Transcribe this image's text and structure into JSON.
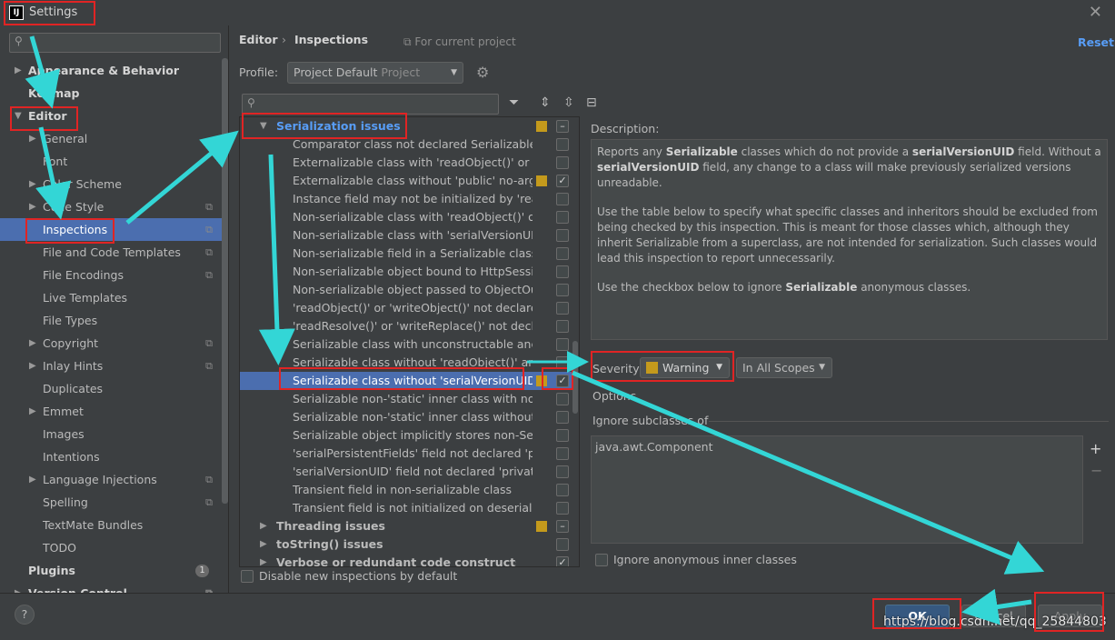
{
  "window": {
    "title": "Settings",
    "app_icon": "IJ"
  },
  "left_panel": {
    "items": [
      {
        "label": "Appearance & Behavior",
        "bold": true,
        "arrow": "right",
        "indent": 0
      },
      {
        "label": "Keymap",
        "bold": true,
        "indent": 0
      },
      {
        "label": "Editor",
        "bold": true,
        "arrow": "down",
        "indent": 0
      },
      {
        "label": "General",
        "arrow": "right",
        "indent": 1
      },
      {
        "label": "Font",
        "indent": 1
      },
      {
        "label": "Color Scheme",
        "arrow": "right",
        "indent": 1
      },
      {
        "label": "Code Style",
        "arrow": "right",
        "indent": 1,
        "copy": true
      },
      {
        "label": "Inspections",
        "indent": 1,
        "copy": true,
        "selected": true
      },
      {
        "label": "File and Code Templates",
        "indent": 1,
        "copy": true
      },
      {
        "label": "File Encodings",
        "indent": 1,
        "copy": true
      },
      {
        "label": "Live Templates",
        "indent": 1
      },
      {
        "label": "File Types",
        "indent": 1
      },
      {
        "label": "Copyright",
        "arrow": "right",
        "indent": 1,
        "copy": true
      },
      {
        "label": "Inlay Hints",
        "arrow": "right",
        "indent": 1,
        "copy": true
      },
      {
        "label": "Duplicates",
        "indent": 1
      },
      {
        "label": "Emmet",
        "arrow": "right",
        "indent": 1
      },
      {
        "label": "Images",
        "indent": 1
      },
      {
        "label": "Intentions",
        "indent": 1
      },
      {
        "label": "Language Injections",
        "arrow": "right",
        "indent": 1,
        "copy": true
      },
      {
        "label": "Spelling",
        "indent": 1,
        "copy": true
      },
      {
        "label": "TextMate Bundles",
        "indent": 1
      },
      {
        "label": "TODO",
        "indent": 1
      },
      {
        "label": "Plugins",
        "bold": true,
        "indent": 0,
        "badge": "1"
      },
      {
        "label": "Version Control",
        "bold": true,
        "arrow": "right",
        "indent": 0,
        "copy": true
      }
    ]
  },
  "header": {
    "crumb_editor": "Editor",
    "crumb_sep": "›",
    "crumb_inspections": "Inspections",
    "for_project": "For current project",
    "reset": "Reset",
    "profile_label": "Profile:",
    "profile_value": "Project Default",
    "profile_scope": "Project"
  },
  "inspections": [
    {
      "label": "Serialization issues",
      "type": "header",
      "sev": true,
      "check": "minus"
    },
    {
      "label": "Comparator class not declared Serializable",
      "check": ""
    },
    {
      "label": "Externalizable class with 'readObject()' or 'writeObject()'",
      "check": ""
    },
    {
      "label": "Externalizable class without 'public' no-arg constructor",
      "sev": true,
      "check": "✓"
    },
    {
      "label": "Instance field may not be initialized by 'readObject()'",
      "check": ""
    },
    {
      "label": "Non-serializable class with 'readObject()' or 'writeObject()'",
      "check": ""
    },
    {
      "label": "Non-serializable class with 'serialVersionUID'",
      "check": ""
    },
    {
      "label": "Non-serializable field in a Serializable class",
      "check": ""
    },
    {
      "label": "Non-serializable object bound to HttpSession",
      "check": ""
    },
    {
      "label": "Non-serializable object passed to ObjectOutputStream",
      "check": ""
    },
    {
      "label": "'readObject()' or 'writeObject()' not declared 'private'",
      "check": ""
    },
    {
      "label": "'readResolve()' or 'writeReplace()' not declared 'protected'",
      "check": ""
    },
    {
      "label": "Serializable class with unconstructable ancestor",
      "check": ""
    },
    {
      "label": "Serializable class without 'readObject()' and 'writeObject()'",
      "check": ""
    },
    {
      "label": "Serializable class without 'serialVersionUID'",
      "sev": true,
      "check": "✓",
      "selected": true
    },
    {
      "label": "Serializable non-'static' inner class with non-Serializable outer class",
      "check": ""
    },
    {
      "label": "Serializable non-'static' inner class without 'serialVersionUID'",
      "check": ""
    },
    {
      "label": "Serializable object implicitly stores non-Serializable object",
      "check": ""
    },
    {
      "label": "'serialPersistentFields' field not declared 'private static final'",
      "check": ""
    },
    {
      "label": "'serialVersionUID' field not declared 'private static final long'",
      "check": ""
    },
    {
      "label": "Transient field in non-serializable class",
      "check": ""
    },
    {
      "label": "Transient field is not initialized on deserialization",
      "check": ""
    },
    {
      "label": "Threading issues",
      "type": "group",
      "sev": true,
      "check": "minus"
    },
    {
      "label": "toString() issues",
      "type": "group",
      "check": ""
    },
    {
      "label": "Verbose or redundant code constructs",
      "type": "group",
      "check": "✓"
    }
  ],
  "disable_new": "Disable new inspections by default",
  "description": {
    "label": "Description:",
    "p1_a": "Reports any ",
    "p1_b": "Serializable",
    "p1_c": " classes which do not provide a ",
    "p1_d": "serialVersionUID",
    "p1_e": " field. Without a ",
    "p1_f": "serialVersionUID",
    "p1_g": " field, any change to a class will make previously serialized versions unreadable.",
    "p2": "Use the table below to specify what specific classes and inheritors should be excluded from being checked by this inspection. This is meant for those classes which, although they inherit Serializable from a superclass, are not intended for serialization. Such classes would lead this inspection to report unnecessarily.",
    "p3_a": "Use the checkbox below to ignore ",
    "p3_b": "Serializable",
    "p3_c": " anonymous classes."
  },
  "severity": {
    "label": "Severity:",
    "value": "Warning",
    "scope": "In All Scopes",
    "color": "#c49a1c"
  },
  "options": {
    "label": "Options",
    "ignore_sub": "Ignore subclasses of",
    "class_item": "java.awt.Component",
    "add": "+",
    "remove": "−",
    "ignore_anon": "Ignore anonymous inner classes"
  },
  "buttons": {
    "help": "?",
    "ok": "OK",
    "cancel": "Cancel",
    "apply": "Apply"
  },
  "watermark": "https://blog.csdn.net/qq_25844803",
  "annotation_colors": {
    "box": "#e02424",
    "arrow": "#33d6d6"
  }
}
